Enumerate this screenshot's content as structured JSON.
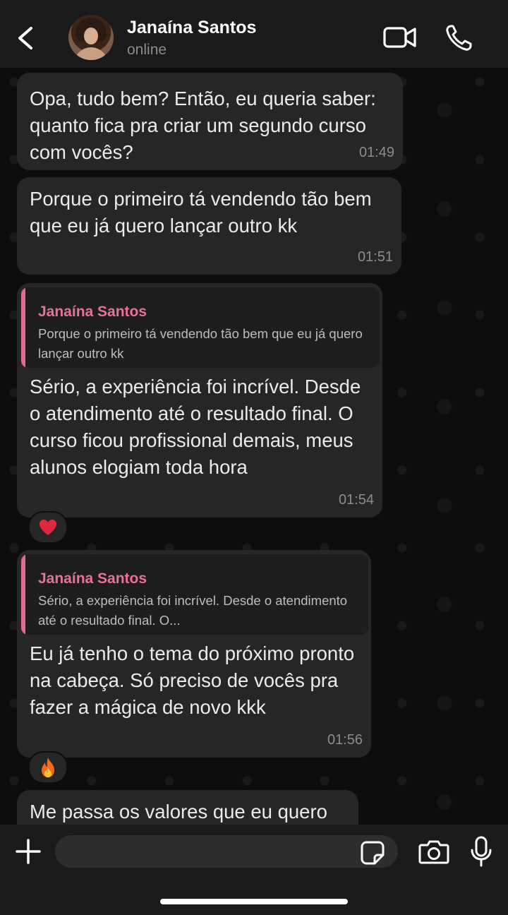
{
  "header": {
    "contact_name": "Janaína Santos",
    "status": "online"
  },
  "messages": [
    {
      "text": "Opa, tudo bem? Então, eu queria saber: quanto fica pra criar um segundo curso com vocês?",
      "time": "01:49"
    },
    {
      "text": "Porque o primeiro tá vendendo tão bem que eu já quero lançar outro kk",
      "time": "01:51"
    },
    {
      "quote_name": "Janaína Santos",
      "quote_text": "Porque o primeiro tá vendendo tão bem que eu já quero lançar outro kk",
      "text": "Sério, a experiência foi incrível. Desde o atendimento até o resultado final. O curso ficou profissional demais, meus alunos elogiam toda hora",
      "time": "01:54",
      "reaction": "❤️"
    },
    {
      "quote_name": "Janaína Santos",
      "quote_text": "Sério, a experiência foi incrível. Desde o atendimento até o resultado final. O...",
      "text": "Eu já tenho o tema do próximo pronto na cabeça. Só preciso de vocês pra fazer a mágica de novo kkk",
      "time": "01:56",
      "reaction": "🔥"
    },
    {
      "text": "Me passa os valores que eu quero"
    }
  ],
  "input": {
    "placeholder": ""
  },
  "colors": {
    "accent_quote": "#e8709a",
    "bubble": "#262626",
    "background": "#0d0d0d"
  }
}
